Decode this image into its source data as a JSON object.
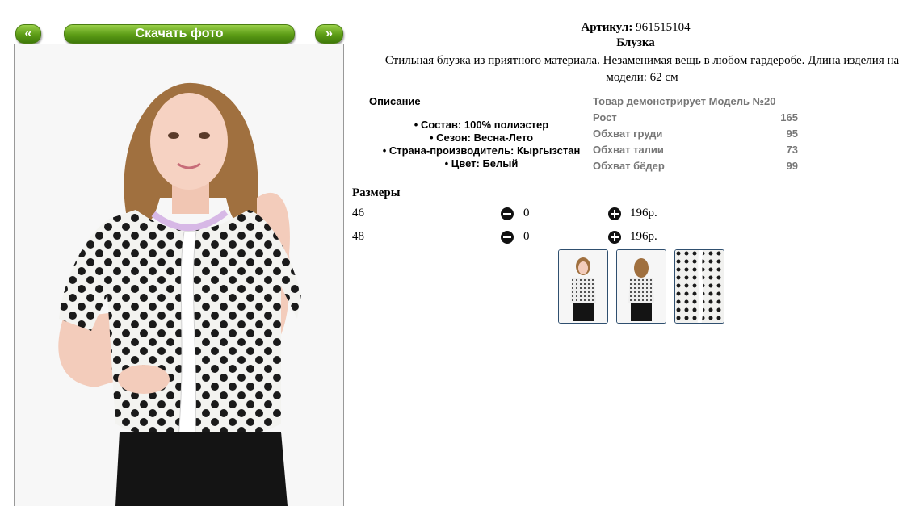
{
  "nav": {
    "prev_label": "«",
    "download_label": "Скачать фото",
    "next_label": "»"
  },
  "product": {
    "article_label": "Артикул:",
    "article_value": "961515104",
    "title": "Блузка",
    "description_line1": "Стильная блузка из приятного материала. Незаменимая вещь в любом гардеробе. Длина изделия на",
    "description_line2": "модели: 62 см"
  },
  "description": {
    "heading": "Описание",
    "items": [
      "• Состав: 100% полиэстер",
      "• Сезон: Весна-Лето",
      "• Страна-производитель: Кыргызстан",
      "• Цвет: Белый"
    ]
  },
  "model": {
    "heading": "Товар демонстрирует Модель №20",
    "rows": [
      {
        "label": "Рост",
        "value": "165"
      },
      {
        "label": "Обхват груди",
        "value": "95"
      },
      {
        "label": "Обхват талии",
        "value": "73"
      },
      {
        "label": "Обхват бёдер",
        "value": "99"
      }
    ]
  },
  "sizes": {
    "heading": "Размеры",
    "rows": [
      {
        "size": "46",
        "qty": "0",
        "price": "196р."
      },
      {
        "size": "48",
        "qty": "0",
        "price": "196р."
      }
    ]
  },
  "colors": {
    "button_green": "#5c9c16",
    "thumb_border": "#2f4f6f",
    "model_text": "#777777"
  }
}
